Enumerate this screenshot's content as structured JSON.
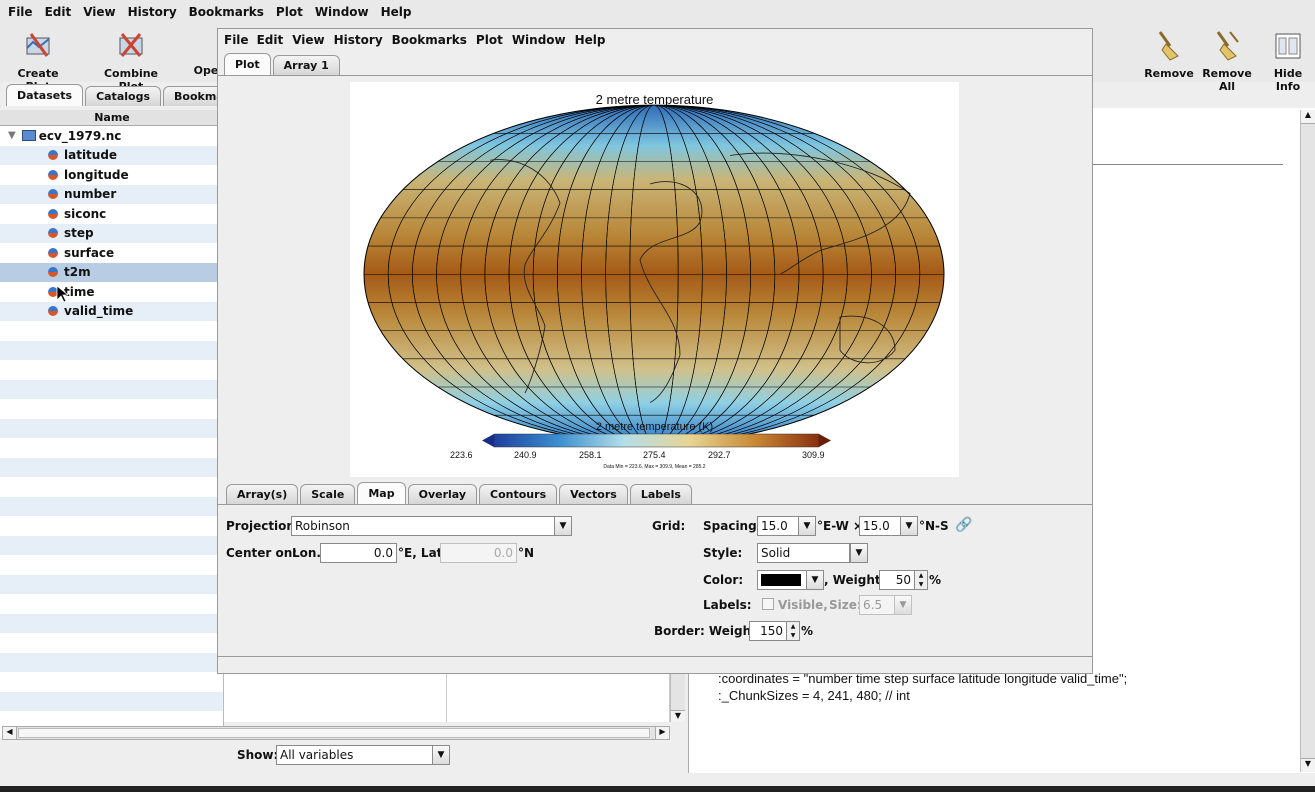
{
  "outer_menu": [
    "File",
    "Edit",
    "View",
    "History",
    "Bookmarks",
    "Plot",
    "Window",
    "Help"
  ],
  "toolbar_left": [
    {
      "label": "Create Plot",
      "icon": "create-plot-icon"
    },
    {
      "label": "Combine Plot",
      "icon": "combine-plot-icon"
    },
    {
      "label": "Ope",
      "icon": "open-icon"
    }
  ],
  "toolbar_right": [
    {
      "label": "Remove",
      "icon": "broom-icon"
    },
    {
      "label": "Remove All",
      "icon": "broom-all-icon"
    },
    {
      "label": "Hide Info",
      "icon": "info-panel-icon"
    }
  ],
  "left_tabs": [
    "Datasets",
    "Catalogs",
    "Bookmark"
  ],
  "tree": {
    "header": "Name",
    "dataset": "ecv_1979.nc",
    "variables": [
      "latitude",
      "longitude",
      "number",
      "siconc",
      "step",
      "surface",
      "t2m",
      "time",
      "valid_time"
    ],
    "selected": "t2m"
  },
  "show": {
    "label": "Show:",
    "value": "All variables"
  },
  "inner_menu": [
    "File",
    "Edit",
    "View",
    "History",
    "Bookmarks",
    "Plot",
    "Window",
    "Help"
  ],
  "inner_tabs": [
    "Plot",
    "Array 1"
  ],
  "plot": {
    "title": "2 metre temperature",
    "colorbar_label": "2 metre temperature (K)",
    "ticks": [
      "223.6",
      "240.9",
      "258.1",
      "275.4",
      "292.7",
      "309.9"
    ],
    "stats": "Data Min = 223.6, Max = 309.9, Mean = 285.2"
  },
  "options_tabs": [
    "Array(s)",
    "Scale",
    "Map",
    "Overlay",
    "Contours",
    "Vectors",
    "Labels"
  ],
  "options_active": "Map",
  "map_options": {
    "projection_label": "Projection:",
    "projection_value": "Robinson",
    "center_label": "Center on:",
    "lon_label": "Lon.",
    "lon_value": "0.0",
    "lon_unit": "°E, Lat.",
    "lat_value": "0.0",
    "lat_unit": "°N",
    "grid_label": "Grid:",
    "spacing_label": "Spacing:",
    "spacing_ew": "15.0",
    "ew_unit": "°E-W ×",
    "spacing_ns": "15.0",
    "ns_unit": "°N-S",
    "style_label": "Style:",
    "style_value": "Solid",
    "color_label": "Color:",
    "weight_label": ", Weight:",
    "weight_value": "50",
    "percent": "%",
    "labels_label": "Labels:",
    "visible_label": "Visible,",
    "size_label": "Size:",
    "size_value": "6.5",
    "border_label": "Border: Weight:",
    "border_value": "150"
  },
  "info_text": [
    ":coordinates = \"number time step surface latitude longitude valid_time\";",
    ":_ChunkSizes = 4, 241, 480; // int"
  ],
  "colors": {
    "accent": "#b8cce4",
    "grid": "#000000"
  }
}
